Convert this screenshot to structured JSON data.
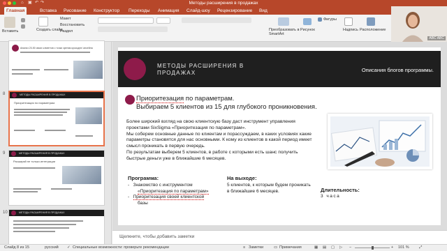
{
  "window": {
    "title": "Методы расширения в продажах",
    "colors": {
      "accent": "#b7472a",
      "slide_band": "#1f1f1f",
      "slide_accent": "#8e1b4a"
    }
  },
  "ribbon_tabs": [
    "Главная",
    "Вставка",
    "Рисование",
    "Конструктор",
    "Переходы",
    "Анимация",
    "Слайд-шоу",
    "Рецензирование",
    "Вид"
  ],
  "ribbon": {
    "paste": "Вставить",
    "new_slide": "Создать слайд",
    "layout": "Макет",
    "reset": "Восстановить",
    "section": "Раздел",
    "smartart": "Преобразовать в SmartArt",
    "picture": "Рисунок",
    "shapes": "Фигуры",
    "textbox": "Надпись",
    "arrange": "Расположение"
  },
  "webcam": {
    "label": "ABC ABC"
  },
  "thumbnails": {
    "numbers": [
      "8",
      "9",
      "10"
    ],
    "t7_title": "Анализ 20-50 своих клиентов с точки зрения кроссдел/ апсейла",
    "t8_band": "МЕТОДЫ РАСШИРЕНИЯ В ПРОДАЖАХ",
    "t8_title": "Приоритезация по параметрам.",
    "t9_band": "МЕТОДЫ РАСШИРЕНИЯ В ПРОДАЖАХ",
    "t9_title": "Расширяй не только интеграции",
    "t10_band": "МЕТОДЫ РАСШИРЕНИЯ В ПРОДАЖАХ"
  },
  "slide": {
    "band_title": "МЕТОДЫ РАСШИРЕНИЯ В ПРОДАЖАХ",
    "band_subtitle": "Описания блогов программы.",
    "heading_pre": "",
    "heading_underlined": "Приоритезация",
    "heading_line1_rest": " по параметрам.",
    "heading_line2": "Выбираем 5 клиентов из 15 для глубокого проникновения.",
    "paragraph": [
      "Более широкий взгляд на свою клиентскую базу даст инструмент управления",
      "проектами SixSigma «Приоритезация по параметрам».",
      "Мы соберем основные данные по клиентам и порассуждаем, в каких условиях какие",
      "параметры становятся для нас основными. К кому из клиентов в какой период имеет",
      "смысл проникать в первую очередь.",
      "По результатам выберем 5 клиентов, в работе с которыми есть шанс получить",
      "быстрые деньги уже в ближайшие 6 месяцев."
    ],
    "program_head": "Программа:",
    "program_items": [
      "Знакомство с инструментом",
      "«Приоритезация по параметрам»",
      "Приоритезация своей клиентской",
      "базы"
    ],
    "output_head": "На выходе:",
    "output_text": [
      "5 клиентов, к которым будем проникать",
      "в ближайшие 6 месяцев."
    ],
    "duration_head": "Длительность:",
    "duration_value": "3 часа"
  },
  "notes": {
    "placeholder": "Щелкните, чтобы добавить заметки"
  },
  "status": {
    "slide_info": "Слайд 8 из 15",
    "language": "русский",
    "accessibility": "Специальные возможности: проверьте рекомендации",
    "notes_btn": "Заметки",
    "comments_btn": "Примечания",
    "zoom": "101 %"
  }
}
